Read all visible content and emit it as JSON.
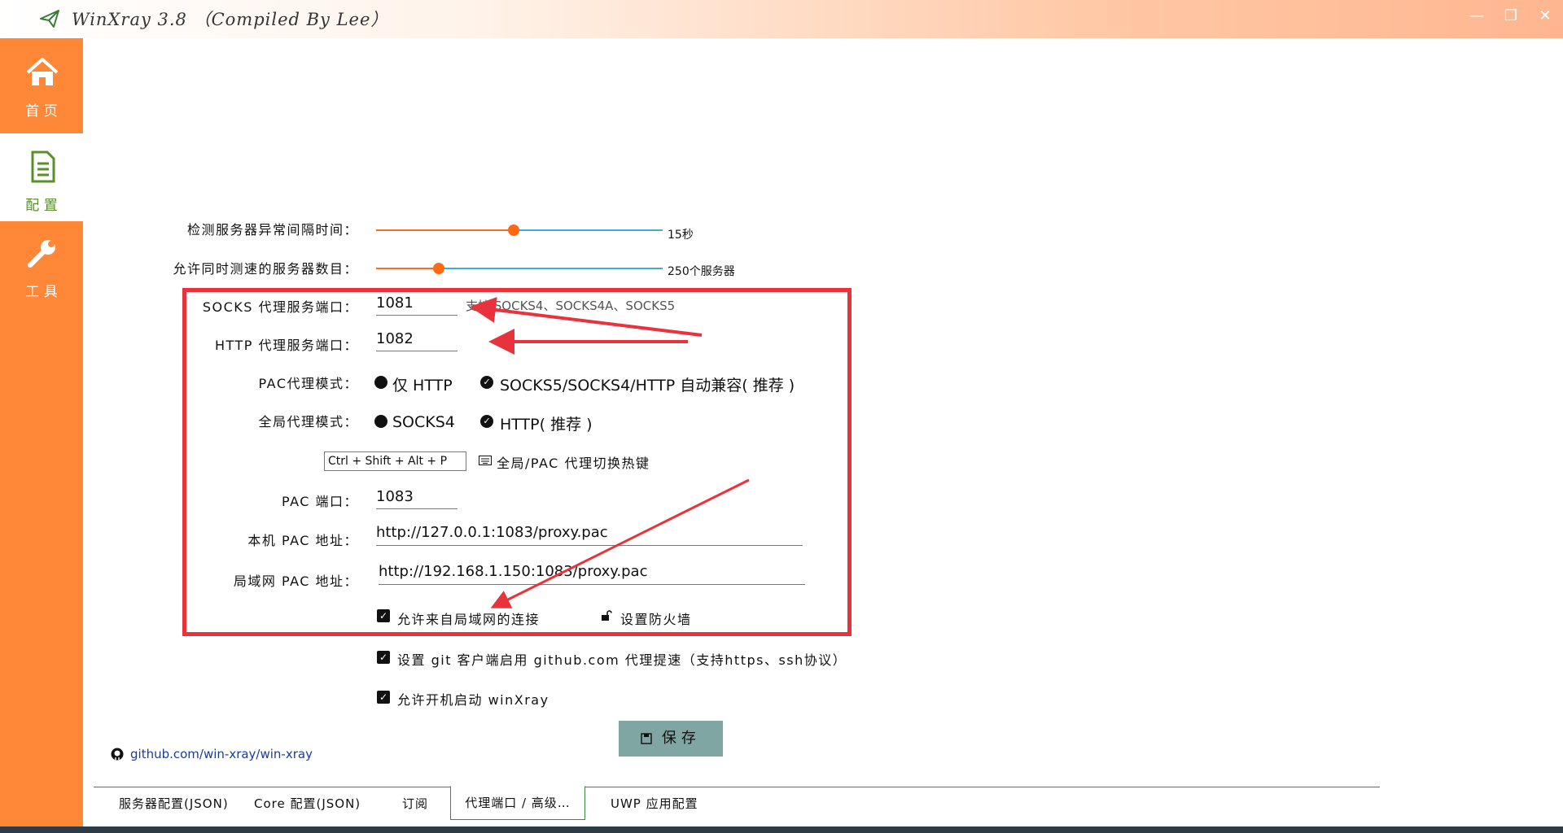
{
  "window": {
    "title": "WinXray  3.8 （Compiled By Lee）",
    "minimize": "—",
    "restore": "❐",
    "close": "✕"
  },
  "sidebar": {
    "items": [
      {
        "label": "首 页"
      },
      {
        "label": "配 置"
      },
      {
        "label": "工 具"
      }
    ]
  },
  "settings": {
    "check_interval": {
      "label": "检测服务器异常间隔时间：",
      "value": "15秒",
      "fraction": 0.48
    },
    "concurrent_servers": {
      "label": "允许同时测速的服务器数目：",
      "value": "250个服务器",
      "fraction": 0.22
    },
    "socks_port": {
      "label": "SOCKS 代理服务端口：",
      "value": "1081",
      "hint": "支持 SOCKS4、SOCKS4A、SOCKS5"
    },
    "http_port": {
      "label": "HTTP 代理服务端口：",
      "value": "1082"
    },
    "pac_mode": {
      "label": "PAC代理模式：",
      "option1": "仅 HTTP",
      "option2": "SOCKS5/SOCKS4/HTTP 自动兼容( 推荐 )"
    },
    "global_mode": {
      "label": "全局代理模式：",
      "option1": "SOCKS4",
      "option2": "HTTP( 推荐 )"
    },
    "hotkey": {
      "value": "Ctrl + Shift + Alt + P",
      "label": "全局/PAC 代理切换热键"
    },
    "pac_port": {
      "label": "PAC 端口：",
      "value": "1083"
    },
    "local_pac": {
      "label": "本机 PAC 地址：",
      "value": "http://127.0.0.1:1083/proxy.pac"
    },
    "lan_pac": {
      "label": "局域网 PAC 地址：",
      "value": "http://192.168.1.150:1083/proxy.pac"
    },
    "allow_lan": {
      "label": "允许来自局域网的连接"
    },
    "firewall": {
      "label": "设置防火墙"
    },
    "git_proxy": {
      "label": "设置 git 客户端启用 github.com 代理提速（支持https、ssh协议）"
    },
    "autostart": {
      "label": "允许开机启动 winXray"
    },
    "save": "保存"
  },
  "footer": {
    "github": "github.com/win-xray/win-xray",
    "tabs": [
      {
        "label": "服务器配置(JSON)"
      },
      {
        "label": "Core 配置(JSON)"
      },
      {
        "label": "订阅"
      },
      {
        "label": "代理端口 / 高级…"
      },
      {
        "label": "UWP 应用配置"
      }
    ]
  },
  "colors": {
    "accent": "#ff8838",
    "annotation": "#e8323c",
    "save_button": "#7fa6a2"
  }
}
